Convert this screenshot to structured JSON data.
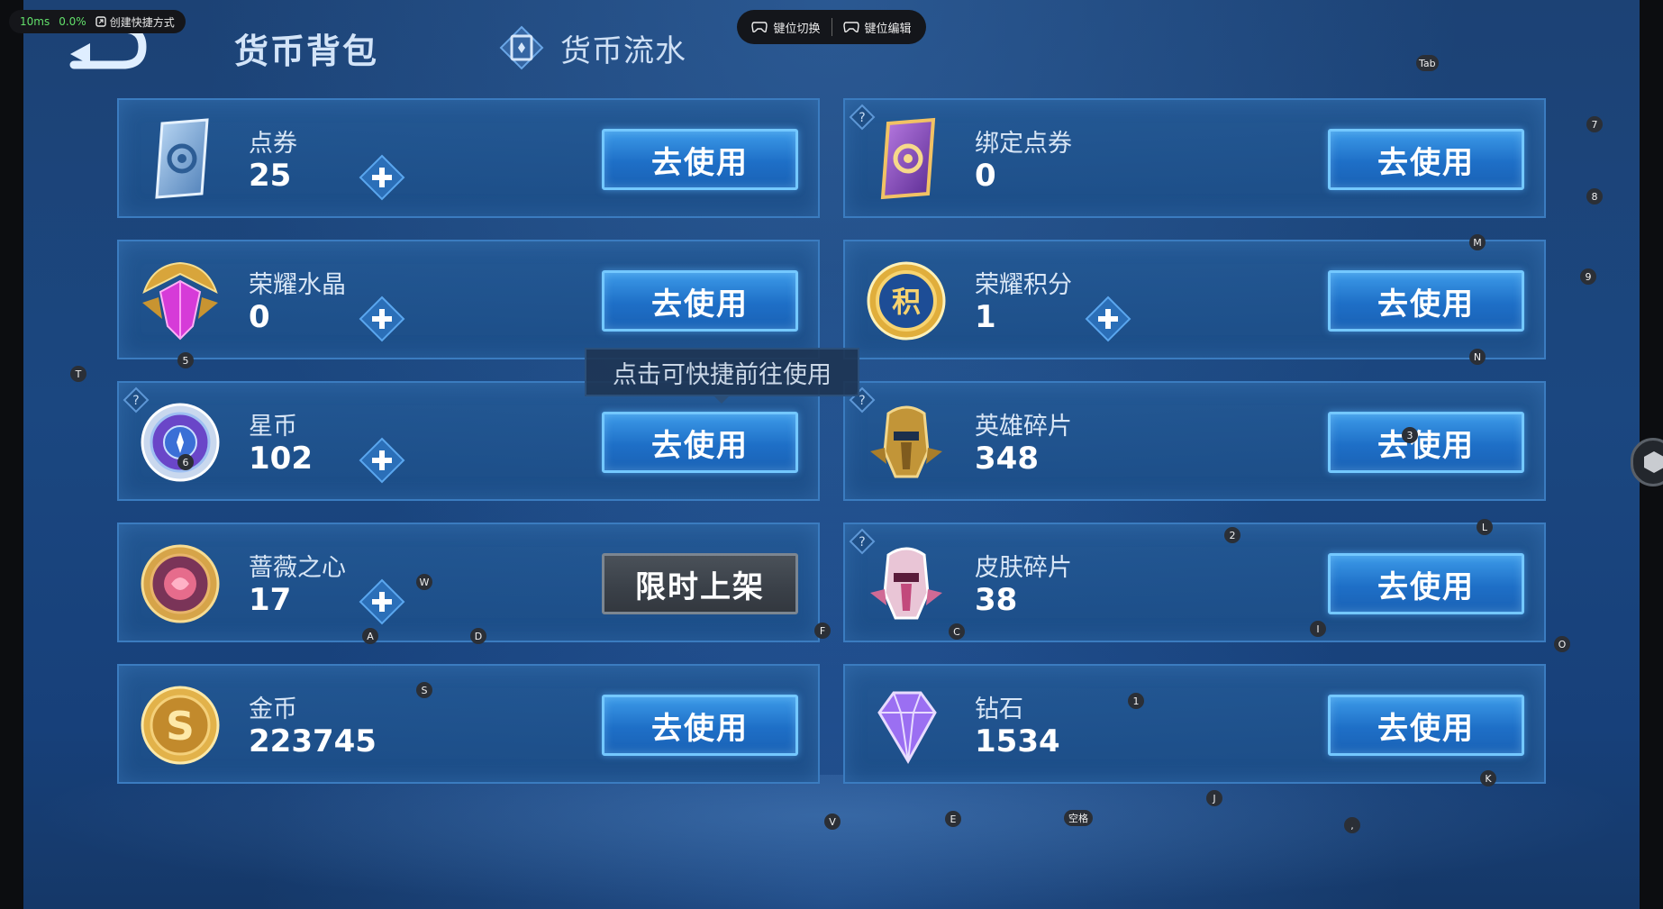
{
  "overlay": {
    "latency": "10ms",
    "loss": "0.0%",
    "shortcut_label": "创建快捷方式"
  },
  "key_toolbar": {
    "switch_label": "键位切换",
    "edit_label": "键位编辑"
  },
  "header": {
    "title": "货币背包",
    "ledger_tab": "货币流水"
  },
  "tooltip": "点击可快捷前往使用",
  "currencies": [
    {
      "name": "点券",
      "amount": "25",
      "button": "去使用",
      "has_plus": true,
      "icon": "voucher-card-icon"
    },
    {
      "name": "绑定点券",
      "amount": "0",
      "button": "去使用",
      "has_plus": false,
      "icon": "bound-voucher-card-icon"
    },
    {
      "name": "荣耀水晶",
      "amount": "0",
      "button": "去使用",
      "has_plus": true,
      "icon": "glory-crystal-icon"
    },
    {
      "name": "荣耀积分",
      "amount": "1",
      "button": "去使用",
      "has_plus": true,
      "icon": "glory-points-icon"
    },
    {
      "name": "星币",
      "amount": "102",
      "button": "去使用",
      "has_plus": true,
      "icon": "star-coin-icon"
    },
    {
      "name": "英雄碎片",
      "amount": "348",
      "button": "去使用",
      "has_plus": false,
      "icon": "hero-fragment-icon"
    },
    {
      "name": "蔷薇之心",
      "amount": "17",
      "button": "限时上架",
      "has_plus": true,
      "icon": "rose-heart-icon"
    },
    {
      "name": "皮肤碎片",
      "amount": "38",
      "button": "去使用",
      "has_plus": false,
      "icon": "skin-fragment-icon"
    },
    {
      "name": "金币",
      "amount": "223745",
      "button": "去使用",
      "has_plus": false,
      "icon": "gold-coin-icon"
    },
    {
      "name": "钻石",
      "amount": "1534",
      "button": "去使用",
      "has_plus": false,
      "icon": "diamond-icon"
    }
  ],
  "key_hints": [
    "Tab",
    "7",
    "8",
    "M",
    "9",
    "N",
    "T",
    "5",
    "6",
    "3",
    "2",
    "L",
    "W",
    "A",
    "D",
    "F",
    "C",
    "I",
    "O",
    "S",
    "1",
    "J",
    "K",
    "V",
    "E",
    "空格",
    ","
  ],
  "colors": {
    "background": "#1b4780",
    "card": "#245a96",
    "card_border": "#3b7cc0",
    "button": "#1e6fc7",
    "button_border": "#74c8ff",
    "disabled_button": "#3a4048"
  }
}
